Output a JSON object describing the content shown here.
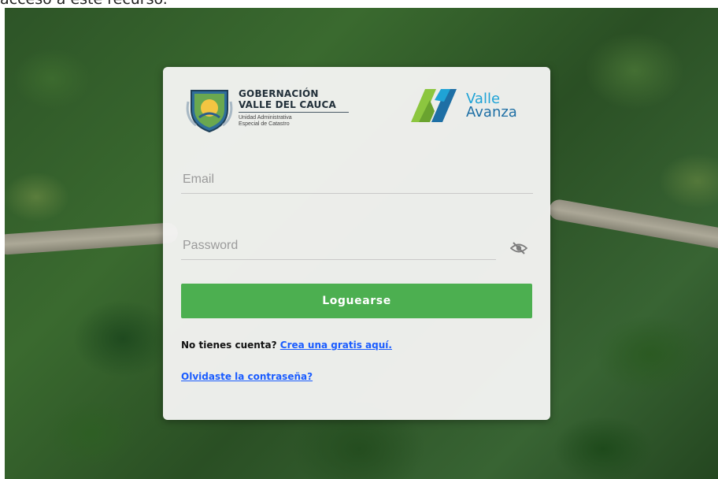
{
  "page": {
    "top_text": "acceso a este recurso."
  },
  "logos": {
    "gov": {
      "line1": "GOBERNACIÓN",
      "line2": "VALLE DEL CAUCA",
      "sub1": "Unidad Administrativa",
      "sub2": "Especial de Catastro"
    },
    "valle_avanza": {
      "line1": "Valle",
      "line2": "Avanza"
    }
  },
  "form": {
    "email": {
      "placeholder": "Email",
      "value": ""
    },
    "password": {
      "placeholder": "Password",
      "value": ""
    },
    "toggle_visibility_icon": "eye-slash-icon",
    "submit_label": "Loguearse",
    "signup_prompt": "No tienes cuenta?",
    "signup_link": "Crea una gratis aquí.",
    "forgot_link": "Olvidaste la contraseña?"
  },
  "colors": {
    "button": "#4caf50",
    "link": "#1a5cff",
    "brand_green": "#8cc63f",
    "brand_blue": "#1e6fa5"
  }
}
